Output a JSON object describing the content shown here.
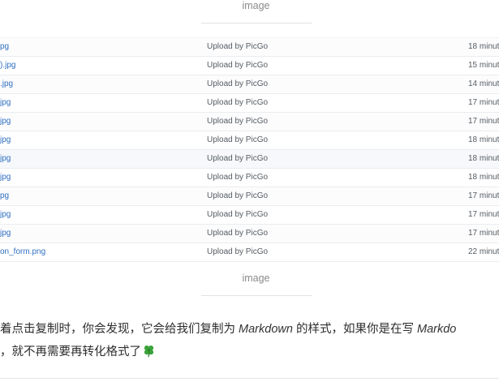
{
  "captions": {
    "top": "image",
    "bottom": "image"
  },
  "file_rows": [
    {
      "name": "pg",
      "message": "Upload by PicGo",
      "age": "18 minut"
    },
    {
      "name": ").jpg",
      "message": "Upload by PicGo",
      "age": "15 minut"
    },
    {
      "name": ".jpg",
      "message": "Upload by PicGo",
      "age": "14 minut"
    },
    {
      "name": "jpg",
      "message": "Upload by PicGo",
      "age": "17 minut"
    },
    {
      "name": "jpg",
      "message": "Upload by PicGo",
      "age": "17 minut"
    },
    {
      "name": "jpg",
      "message": "Upload by PicGo",
      "age": "18 minut"
    },
    {
      "name": "jpg",
      "message": "Upload by PicGo",
      "age": "18 minut"
    },
    {
      "name": "jpg",
      "message": "Upload by PicGo",
      "age": "18 minut"
    },
    {
      "name": "pg",
      "message": "Upload by PicGo",
      "age": "17 minut"
    },
    {
      "name": "jpg",
      "message": "Upload by PicGo",
      "age": "17 minut"
    },
    {
      "name": "jpg",
      "message": "Upload by PicGo",
      "age": "17 minut"
    },
    {
      "name": "on_form.png",
      "message": "Upload by PicGo",
      "age": "22 minut"
    }
  ],
  "paragraph": {
    "line1_a": "着点击复制时，你会发现，它会给我们复制为 ",
    "line1_em1": "Markdown",
    "line1_b": " 的样式，如果你是在写 ",
    "line1_em2": "Markdo",
    "line2": "，就不再需要再转化格式了"
  },
  "icons": {
    "clover": "four-leaf-clover-icon"
  },
  "colors": {
    "link": "#2f6fc0",
    "muted": "#555c63",
    "clover": "#3aa33a"
  }
}
